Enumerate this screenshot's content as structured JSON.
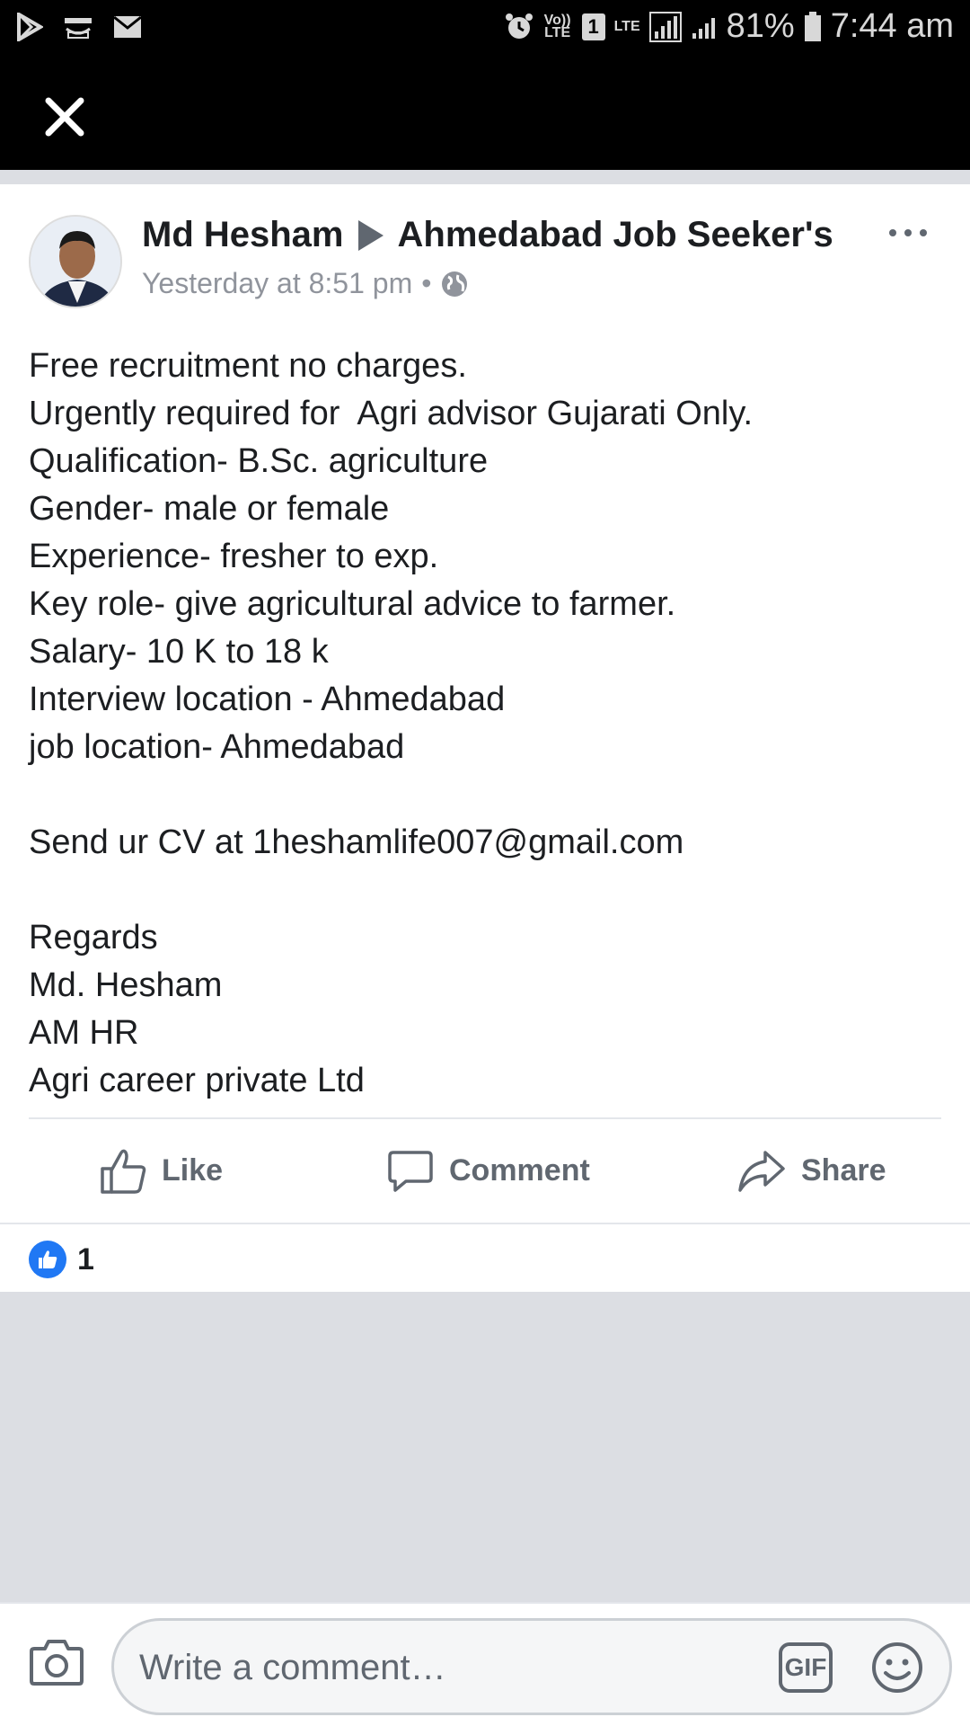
{
  "status_bar": {
    "battery_percent": "81%",
    "time": "7:44 am",
    "volte_label": "Vo)) LTE",
    "sim_label": "1",
    "lte_label": "LTE"
  },
  "post": {
    "author": "Md Hesham",
    "group": "Ahmedabad Job Seeker's",
    "timestamp": "Yesterday at 8:51 pm",
    "separator": "•",
    "privacy_icon": "globe-icon",
    "body_lines": [
      "Free recruitment no charges.",
      "Urgently required for  Agri advisor Gujarati Only.",
      "Qualification- B.Sc. agriculture",
      "Gender- male or female",
      "Experience- fresher to exp.",
      "Key role- give agricultural advice to farmer.",
      "Salary- 10 K to 18 k",
      "Interview location - Ahmedabad",
      "job location- Ahmedabad",
      "",
      "Send ur CV at 1heshamlife007@gmail.com",
      "",
      "Regards",
      "Md. Hesham",
      "AM HR",
      "Agri career private Ltd"
    ]
  },
  "actions": {
    "like": "Like",
    "comment": "Comment",
    "share": "Share"
  },
  "reactions": {
    "like_count": "1"
  },
  "comment_bar": {
    "placeholder": "Write a comment…",
    "gif_label": "GIF"
  },
  "colors": {
    "accent": "#2078f4",
    "text": "#1c1e21",
    "muted": "#606770"
  }
}
